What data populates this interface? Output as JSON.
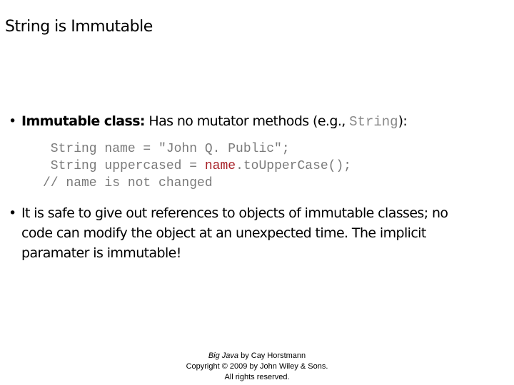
{
  "slide": {
    "title": "String is Immutable",
    "bullet1": {
      "bullet_glyph": "•",
      "strong": "Immutable class:",
      "text": " Has no mutator methods (e.g., ",
      "code": "String",
      "tail": "):"
    },
    "code_block": {
      "line1": " String name = \"John Q. Public\";",
      "line2_pre": " String uppercased = ",
      "line2_hl": "name",
      "line2_post": ".toUpperCase();",
      "line3": "// name is not changed"
    },
    "bullet2": {
      "bullet_glyph": "•",
      "line1": "It is safe to give out references to objects of immutable classes; no",
      "line2": "code can modify the object at an unexpected time. The implicit",
      "line3": "paramater is immutable!"
    },
    "footer": {
      "book": "Big Java",
      "by": " by Cay Horstmann",
      "copyright": "Copyright © 2009 by John Wiley & Sons.",
      "rights": "All rights reserved."
    },
    "colors": {
      "code_text": "#7a7a7a",
      "highlight": "#a8232a"
    }
  }
}
